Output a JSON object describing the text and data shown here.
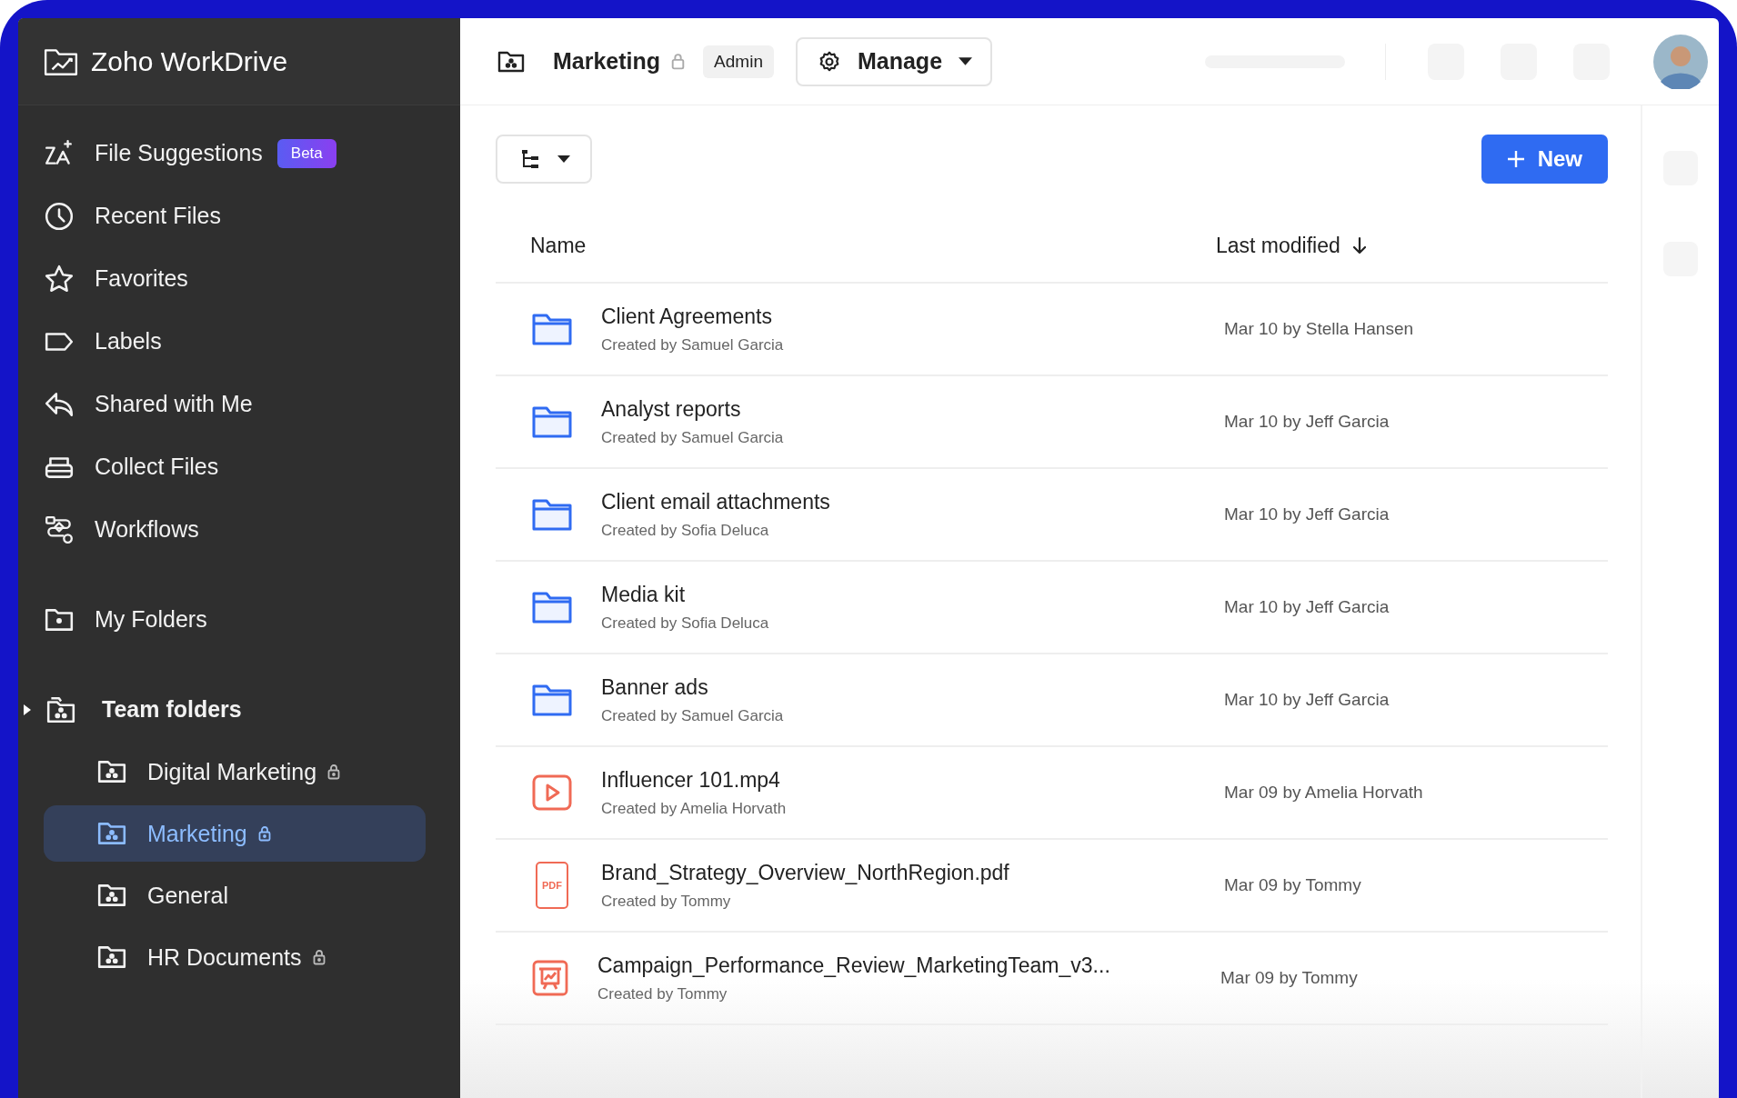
{
  "app": {
    "name": "Zoho WorkDrive"
  },
  "header": {
    "folder": "Marketing",
    "locked": true,
    "role": "Admin",
    "manage_button": "Manage"
  },
  "sidebar": {
    "nav": [
      {
        "label": "File Suggestions",
        "kind": "suggestions",
        "badge": "Beta"
      },
      {
        "label": "Recent Files",
        "kind": "recent"
      },
      {
        "label": "Favorites",
        "kind": "favorites"
      },
      {
        "label": "Labels",
        "kind": "labels"
      },
      {
        "label": "Shared with Me",
        "kind": "shared"
      },
      {
        "label": "Collect Files",
        "kind": "collect"
      },
      {
        "label": "Workflows",
        "kind": "workflows"
      }
    ],
    "my_folders": {
      "label": "My Folders"
    },
    "team_folders": {
      "label": "Team folders",
      "children": [
        {
          "label": "Digital Marketing",
          "locked": true,
          "selected": false
        },
        {
          "label": "Marketing",
          "locked": true,
          "selected": true
        },
        {
          "label": "General",
          "locked": false,
          "selected": false
        },
        {
          "label": "HR Documents",
          "locked": true,
          "selected": false
        }
      ]
    }
  },
  "toolbar": {
    "new_button": "New"
  },
  "table": {
    "columns": [
      "Name",
      "Last modified"
    ],
    "rows": [
      {
        "kind": "folder",
        "name": "Client Agreements",
        "created_by": "Created by Samuel Garcia",
        "modified": "Mar 10 by Stella Hansen"
      },
      {
        "kind": "folder",
        "name": "Analyst reports",
        "created_by": "Created by Samuel Garcia",
        "modified": "Mar 10 by Jeff Garcia"
      },
      {
        "kind": "folder",
        "name": "Client email attachments",
        "created_by": "Created by Sofia Deluca",
        "modified": "Mar 10 by Jeff Garcia"
      },
      {
        "kind": "folder",
        "name": "Media kit",
        "created_by": "Created by Sofia Deluca",
        "modified": "Mar 10 by Jeff Garcia"
      },
      {
        "kind": "folder",
        "name": "Banner ads",
        "created_by": "Created by Samuel Garcia",
        "modified": "Mar 10 by Jeff Garcia"
      },
      {
        "kind": "video",
        "name": "Influencer 101.mp4",
        "created_by": "Created by Amelia Horvath",
        "modified": "Mar 09 by Amelia Horvath"
      },
      {
        "kind": "pdf",
        "icon_text": "PDF",
        "name": "Brand_Strategy_Overview_NorthRegion.pdf",
        "created_by": "Created by Tommy",
        "modified": "Mar 09 by Tommy"
      },
      {
        "kind": "presentation",
        "name": "Campaign_Performance_Review_MarketingTeam_v3...",
        "created_by": "Created by Tommy",
        "modified": "Mar 09 by Tommy"
      }
    ]
  }
}
